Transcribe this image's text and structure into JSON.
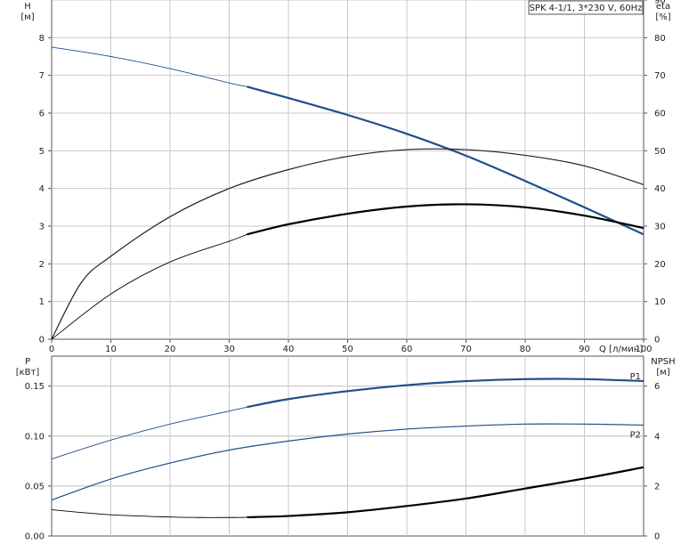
{
  "title": "SPK 4-1/1, 3*230 V, 60Hz",
  "chart_data": [
    {
      "type": "line",
      "name": "head-efficiency",
      "x_axis": {
        "label": "Q [л/мин]",
        "range": [
          0,
          100
        ],
        "ticks": [
          0,
          10,
          20,
          30,
          40,
          50,
          60,
          70,
          80,
          90,
          100
        ]
      },
      "y_left": {
        "label_top": "H",
        "label_unit": "[м]",
        "range": [
          0,
          9
        ],
        "ticks": [
          0,
          1,
          2,
          3,
          4,
          5,
          6,
          7,
          8
        ]
      },
      "y_right": {
        "label_top": "eta",
        "label_unit": "[%]",
        "range": [
          0,
          90
        ],
        "ticks": [
          0,
          10,
          20,
          30,
          40,
          50,
          60,
          70,
          80,
          90
        ]
      },
      "grid": true,
      "series": [
        {
          "id": "H",
          "axis": "left",
          "color": "#1f4e8c",
          "bold_from": 33,
          "x": [
            0,
            10,
            20,
            30,
            33,
            40,
            50,
            60,
            70,
            80,
            90,
            100
          ],
          "y": [
            7.75,
            7.5,
            7.18,
            6.8,
            6.7,
            6.4,
            5.95,
            5.45,
            4.87,
            4.2,
            3.5,
            2.78
          ]
        },
        {
          "id": "eta_upper",
          "axis": "right",
          "color": "#222222",
          "bold_from": null,
          "x": [
            0,
            5,
            10,
            20,
            30,
            40,
            50,
            60,
            70,
            80,
            90,
            100
          ],
          "y": [
            0,
            15,
            22,
            32.5,
            40,
            45,
            48.5,
            50.3,
            50.3,
            48.8,
            46,
            41
          ]
        },
        {
          "id": "eta_lower",
          "axis": "right",
          "color": "#000000",
          "bold_from": 33,
          "x": [
            0,
            10,
            20,
            30,
            33,
            40,
            50,
            60,
            70,
            80,
            90,
            100
          ],
          "y": [
            0,
            12,
            20.5,
            26,
            27.8,
            30.5,
            33.3,
            35.2,
            35.8,
            35,
            32.8,
            29.5
          ]
        }
      ]
    },
    {
      "type": "line",
      "name": "power-npsh",
      "x_axis": {
        "range": [
          0,
          100
        ]
      },
      "y_left": {
        "label_top": "P",
        "label_unit": "[кВт]",
        "range": [
          0,
          0.18
        ],
        "ticks": [
          "0.00",
          "0.05",
          "0.10",
          "0.15"
        ],
        "tick_values": [
          0,
          0.05,
          0.1,
          0.15
        ]
      },
      "y_right": {
        "label_top": "NPSH",
        "label_unit": "[м]",
        "range": [
          0,
          7.2
        ],
        "ticks": [
          0,
          2,
          4,
          6
        ]
      },
      "grid": true,
      "series": [
        {
          "id": "P1",
          "name": "P1",
          "axis": "left",
          "color": "#1f4e8c",
          "bold_from": 33,
          "x": [
            0,
            10,
            20,
            30,
            33,
            40,
            50,
            60,
            70,
            80,
            90,
            100
          ],
          "y": [
            0.077,
            0.096,
            0.112,
            0.125,
            0.129,
            0.137,
            0.145,
            0.151,
            0.155,
            0.157,
            0.157,
            0.155
          ]
        },
        {
          "id": "P2",
          "name": "P2",
          "axis": "left",
          "color": "#1f4e8c",
          "bold_from": null,
          "x": [
            0,
            10,
            20,
            30,
            40,
            50,
            60,
            70,
            80,
            90,
            100
          ],
          "y": [
            0.036,
            0.057,
            0.073,
            0.086,
            0.095,
            0.102,
            0.107,
            0.11,
            0.112,
            0.112,
            0.111
          ]
        },
        {
          "id": "NPSH",
          "axis": "right",
          "color": "#000000",
          "bold_from": 33,
          "x": [
            0,
            10,
            20,
            25,
            30,
            33,
            40,
            50,
            60,
            70,
            80,
            90,
            100
          ],
          "y": [
            1.05,
            0.85,
            0.76,
            0.74,
            0.74,
            0.75,
            0.8,
            0.95,
            1.2,
            1.5,
            1.9,
            2.3,
            2.75
          ]
        }
      ]
    }
  ]
}
